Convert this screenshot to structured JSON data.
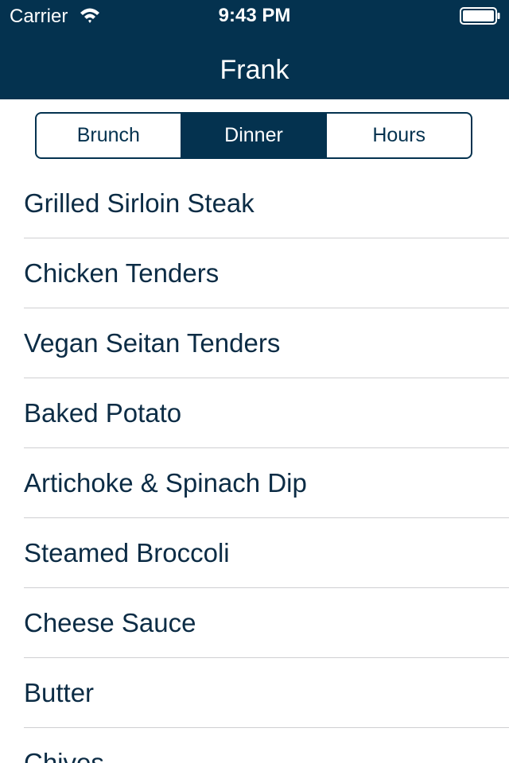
{
  "status_bar": {
    "carrier": "Carrier",
    "time": "9:43 PM",
    "wifi_icon": "wifi-icon",
    "battery_icon": "battery-icon"
  },
  "nav": {
    "title": "Frank"
  },
  "segments": {
    "items": [
      {
        "label": "Brunch",
        "selected": false
      },
      {
        "label": "Dinner",
        "selected": true
      },
      {
        "label": "Hours",
        "selected": false
      }
    ]
  },
  "menu": {
    "items": [
      {
        "label": "Grilled Sirloin Steak"
      },
      {
        "label": "Chicken Tenders"
      },
      {
        "label": "Vegan Seitan Tenders"
      },
      {
        "label": "Baked Potato"
      },
      {
        "label": "Artichoke & Spinach Dip"
      },
      {
        "label": "Steamed Broccoli"
      },
      {
        "label": "Cheese Sauce"
      },
      {
        "label": "Butter"
      },
      {
        "label": "Chives"
      }
    ]
  },
  "colors": {
    "navbar": "#04324f",
    "text": "#0c2c45",
    "separator": "#cfcfd2"
  }
}
